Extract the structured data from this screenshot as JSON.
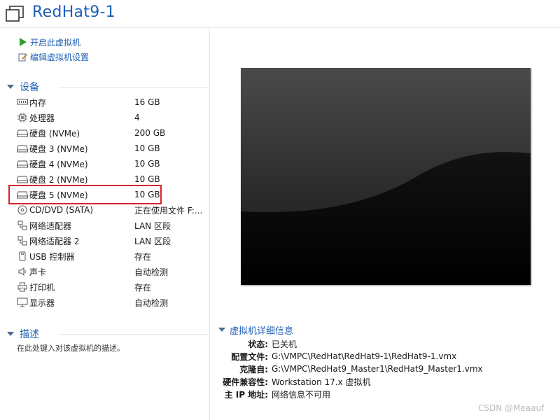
{
  "header": {
    "title": "RedHat9-1"
  },
  "actions": [
    {
      "label": "开启此虚拟机",
      "icon": "play-icon"
    },
    {
      "label": "编辑虚拟机设置",
      "icon": "edit-settings-icon"
    }
  ],
  "devices": {
    "heading": "设备",
    "items": [
      {
        "name": "内存",
        "value": "16 GB",
        "icon": "memory-icon"
      },
      {
        "name": "处理器",
        "value": "4",
        "icon": "cpu-icon"
      },
      {
        "name": "硬盘 (NVMe)",
        "value": "200 GB",
        "icon": "hard-disk-icon"
      },
      {
        "name": "硬盘 3 (NVMe)",
        "value": "10 GB",
        "icon": "hard-disk-icon"
      },
      {
        "name": "硬盘 4 (NVMe)",
        "value": "10 GB",
        "icon": "hard-disk-icon"
      },
      {
        "name": "硬盘 2 (NVMe)",
        "value": "10 GB",
        "icon": "hard-disk-icon"
      },
      {
        "name": "硬盘 5 (NVMe)",
        "value": "10 GB",
        "icon": "hard-disk-icon"
      },
      {
        "name": "CD/DVD (SATA)",
        "value": "正在使用文件 F:...",
        "icon": "cd-dvd-icon"
      },
      {
        "name": "网络适配器",
        "value": "LAN 区段",
        "icon": "network-adapter-icon"
      },
      {
        "name": "网络适配器 2",
        "value": "LAN 区段",
        "icon": "network-adapter-icon"
      },
      {
        "name": "USB 控制器",
        "value": "存在",
        "icon": "usb-icon"
      },
      {
        "name": "声卡",
        "value": "自动检测",
        "icon": "sound-icon"
      },
      {
        "name": "打印机",
        "value": "存在",
        "icon": "printer-icon"
      },
      {
        "name": "显示器",
        "value": "自动检测",
        "icon": "display-icon"
      }
    ]
  },
  "description": {
    "heading": "描述",
    "text": "在此处键入对该虚拟机的描述。"
  },
  "details": {
    "heading": "虚拟机详细信息",
    "rows": [
      {
        "key": "状态:",
        "value": "已关机"
      },
      {
        "key": "配置文件:",
        "value": "G:\\VMPC\\RedHat\\RedHat9-1\\RedHat9-1.vmx"
      },
      {
        "key": "克隆自:",
        "value": "G:\\VMPC\\RedHat9_Master1\\RedHat9_Master1.vmx"
      },
      {
        "key": "硬件兼容性:",
        "value": "Workstation 17.x 虚拟机"
      },
      {
        "key": "主 IP 地址:",
        "value": "网络信息不可用"
      }
    ]
  },
  "watermark": "CSDN @Meaauf",
  "colors": {
    "accent": "#1f5fb4",
    "highlight_border": "#d9252b"
  }
}
